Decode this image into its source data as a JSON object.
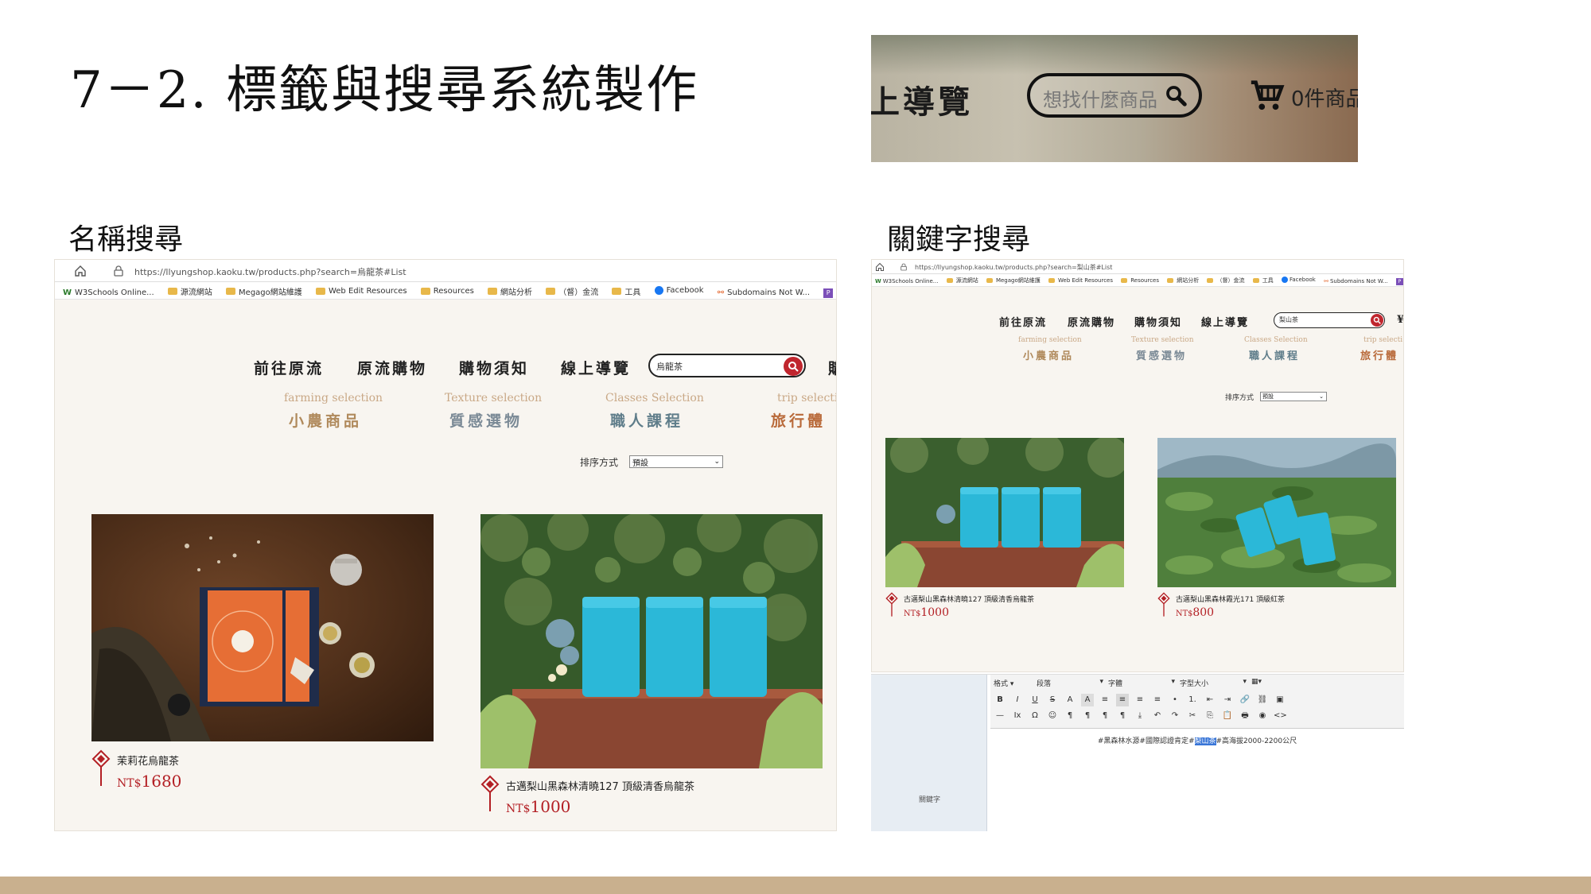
{
  "slide": {
    "title": "7－2. 標籤與搜尋系統製作",
    "left_heading": "名稱搜尋",
    "right_heading": "關鍵字搜尋"
  },
  "zoom": {
    "nav_fragment": "上導覽",
    "search_placeholder": "想找什麼商品",
    "cart_text": "0件商品"
  },
  "left_shot": {
    "url": "https://llyungshop.kaoku.tw/products.php?search=烏龍茶#List",
    "bookmarks": [
      "W3Schools Online...",
      "源流網站",
      "Megago網站維護",
      "Web Edit Resources",
      "Resources",
      "網站分析",
      "（督）金流",
      "工具",
      "Facebook",
      "Subdomains Not W...",
      "P"
    ],
    "nav": [
      "前往原流",
      "原流購物",
      "購物須知",
      "線上導覽"
    ],
    "nav_more": "購",
    "search_value": "烏龍茶",
    "categories": [
      {
        "en": "farming selection",
        "zh": "小農商品",
        "color": "#b08a5c"
      },
      {
        "en": "Texture selection",
        "zh": "質感選物",
        "color": "#7b8a96"
      },
      {
        "en": "Classes Selection",
        "zh": "職人課程",
        "color": "#5f7d8a"
      },
      {
        "en": "trip selectio",
        "zh": "旅行體",
        "color": "#b96a3a"
      }
    ],
    "sort_label": "排序方式",
    "sort_value": "預設",
    "products": [
      {
        "name": "茉莉花烏龍茶",
        "currency": "NT$",
        "price": "1680"
      },
      {
        "name": "古邁梨山黑森林清曉127 頂級清香烏龍茶",
        "currency": "NT$",
        "price": "1000"
      }
    ]
  },
  "right_shot": {
    "url": "https://llyungshop.kaoku.tw/products.php?search=梨山茶#List",
    "bookmarks": [
      "W3Schools Online...",
      "源流網站",
      "Megago網站維護",
      "Web Edit Resources",
      "Resources",
      "網站分析",
      "（督）金流",
      "工具",
      "Facebook",
      "Subdomains Not W...",
      "P"
    ],
    "nav": [
      "前往原流",
      "原流購物",
      "購物須知",
      "線上導覽"
    ],
    "nav_more": "¥",
    "search_value": "梨山茶",
    "categories": [
      {
        "en": "farming selection",
        "zh": "小農商品",
        "color": "#b08a5c"
      },
      {
        "en": "Texture selection",
        "zh": "質感選物",
        "color": "#7b8a96"
      },
      {
        "en": "Classes Selection",
        "zh": "職人課程",
        "color": "#5f7d8a"
      },
      {
        "en": "trip selecti",
        "zh": "旅行體",
        "color": "#b96a3a"
      }
    ],
    "sort_label": "排序方式",
    "sort_value": "預設",
    "products": [
      {
        "name": "古邁梨山黑森林清曉127 頂級清香烏龍茶",
        "currency": "NT$",
        "price": "1000"
      },
      {
        "name": "古邁梨山黑森林霞光171 頂級紅茶",
        "currency": "NT$",
        "price": "800"
      }
    ]
  },
  "editor": {
    "side_label": "關鍵字",
    "row1": [
      "格式",
      "段落",
      "字體",
      "字型大小"
    ],
    "row2": [
      "B",
      "I",
      "U",
      "S",
      "A",
      "A",
      "≡",
      "≡",
      "≡",
      "≡",
      "•",
      "1.",
      "⇤",
      "⇥",
      "🔗",
      "⛓",
      "▣"
    ],
    "row3": [
      "—",
      "Ix",
      "Ω",
      "☺",
      "¶",
      "¶",
      "¶",
      "¶",
      "⤓",
      "↶",
      "↷",
      "✂",
      "⎘",
      "📋",
      "🖶",
      "◉",
      "<>"
    ],
    "content_before": "#黑森林水源#國際認證肯定#",
    "content_highlight": "梨山茶",
    "content_after": "#高海拔2000-2200公尺"
  },
  "colors": {
    "accent_red": "#b31f24",
    "bottom_bar": "#c9b08e"
  }
}
